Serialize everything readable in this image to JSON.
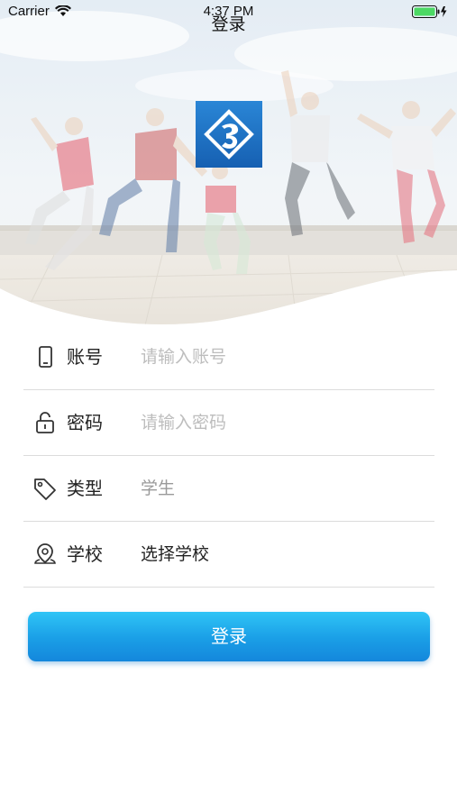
{
  "status_bar": {
    "carrier": "Carrier",
    "time": "4:37 PM"
  },
  "nav": {
    "title": "登录"
  },
  "hero": {
    "logo": "app-logo"
  },
  "form": {
    "account": {
      "label": "账号",
      "placeholder": "请输入账号",
      "value": "",
      "icon": "phone-icon"
    },
    "password": {
      "label": "密码",
      "placeholder": "请输入密码",
      "value": "",
      "icon": "lock-icon"
    },
    "type": {
      "label": "类型",
      "value": "学生",
      "icon": "tag-icon"
    },
    "school": {
      "label": "学校",
      "value": "选择学校",
      "icon": "location-pin-icon"
    }
  },
  "login_button": {
    "label": "登录"
  },
  "colors": {
    "button_top": "#2fc4f6",
    "button_bottom": "#1487dc",
    "logo_blue": "#1f73c6",
    "divider": "#dcdcdc",
    "placeholder": "#bdbdbd"
  }
}
